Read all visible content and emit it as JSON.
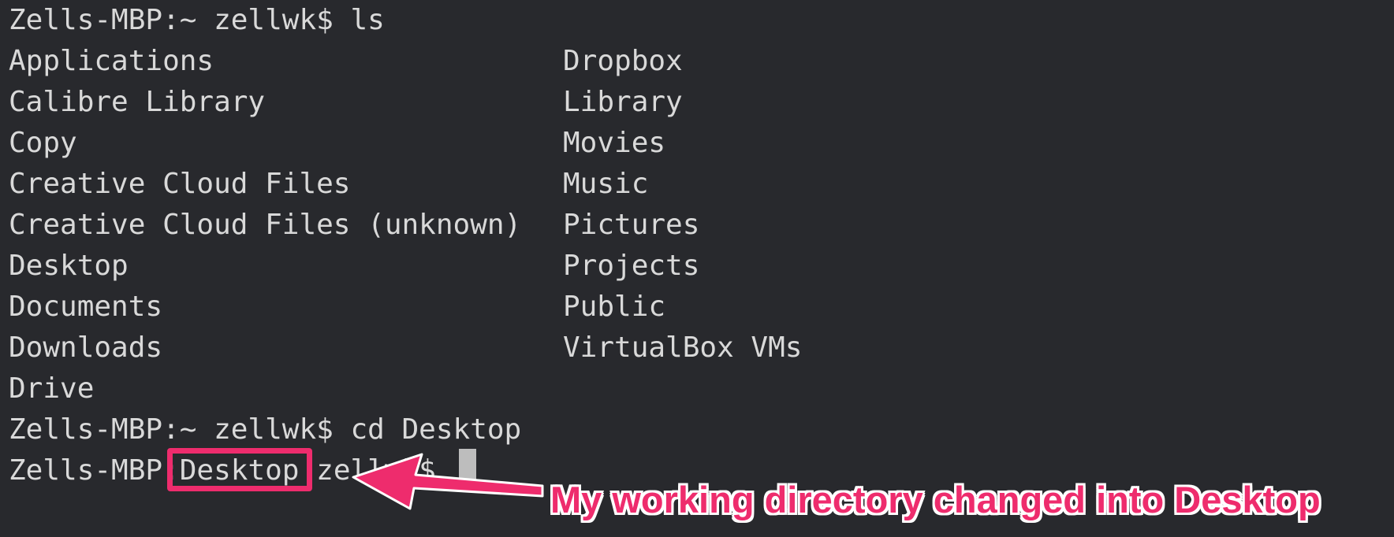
{
  "terminal": {
    "prompt_home": "Zells-MBP:~ zellwk$ ",
    "command_ls": "ls",
    "listing": {
      "left": [
        "Applications",
        "Calibre Library",
        "Copy",
        "Creative Cloud Files",
        "Creative Cloud Files (unknown)",
        "Desktop",
        "Documents",
        "Downloads",
        "Drive"
      ],
      "right": [
        "Dropbox",
        "Library",
        "Movies",
        "Music",
        "Pictures",
        "Projects",
        "Public",
        "VirtualBox VMs"
      ]
    },
    "command_cd": "cd Desktop",
    "prompt_desktop_host": "Zells-MBP:",
    "prompt_desktop_dir": "Desktop",
    "prompt_desktop_user": " zellwk$ "
  },
  "annotation": {
    "text": "My working directory changed into Desktop",
    "color": "#ee2c6d"
  },
  "colors": {
    "background": "#28292d",
    "text": "#d9d9d9",
    "cursor": "#bdbdbd"
  }
}
